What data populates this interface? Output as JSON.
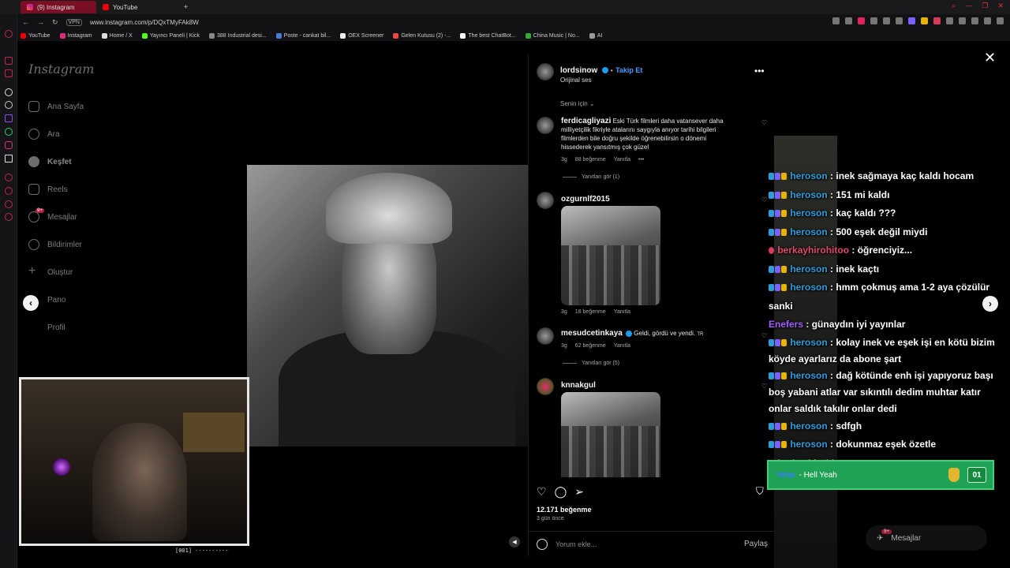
{
  "browser": {
    "tabs": [
      {
        "label": "(9) Instagram",
        "active": true
      },
      {
        "label": "YouTube",
        "active": false
      }
    ],
    "url": "www.instagram.com/p/DQxTMyFAk8W",
    "vpn_label": "VPN",
    "bookmarks": [
      "YouTube",
      "Instagram",
      "Home / X",
      "Yayıncı Paneli | Kick",
      "388 Industrial desi...",
      "Poste - cankat bil...",
      "OEX Screener",
      "Gelen Kutusu (2) -...",
      "The best ChatBot...",
      "China Music | No...",
      "AI"
    ]
  },
  "sidebar": {
    "logo": "Instagram",
    "items": [
      {
        "label": "Ana Sayfa",
        "icon": "home-icon"
      },
      {
        "label": "Ara",
        "icon": "search-icon"
      },
      {
        "label": "Keşfet",
        "icon": "compass-icon"
      },
      {
        "label": "Reels",
        "icon": "reels-icon"
      },
      {
        "label": "Mesajlar",
        "icon": "messenger-icon",
        "badge": "9+"
      },
      {
        "label": "Bildirimler",
        "icon": "heart-icon"
      },
      {
        "label": "Oluştur",
        "icon": "plus-icon"
      },
      {
        "label": "Pano",
        "icon": "dashboard-icon"
      },
      {
        "label": "Profil",
        "icon": "profile-icon"
      }
    ]
  },
  "post": {
    "author": "lordsinow",
    "follow_label": "Takip Et",
    "audio": "Orijinal ses",
    "sort_label": "Senin için",
    "likes": "12.171 beğenme",
    "time_ago": "3 gün önce",
    "comment_placeholder": "Yorum ekle...",
    "share_label": "Paylaş",
    "comments": [
      {
        "user": "ferdicagliyazi",
        "text": "Eski Türk filmleri daha vatansever daha milliyetçilik fikriyle atalarını saygıyla anıyor tarihi bilgileri filmlerden bile doğru şekilde öğrenebilirsin o dönemi hissederek yansıtmış çok güzel",
        "age": "3g",
        "likes": "88 beğenme",
        "reply": "Yanıtla",
        "replies": "Yanıtları gör (1)"
      },
      {
        "user": "ozgurnlf2015",
        "text": "",
        "age": "3g",
        "likes": "18 beğenme",
        "reply": "Yanıtla"
      },
      {
        "user": "mesudcetinkaya",
        "text": "Geldi, gördü ve yendi.",
        "flag": "TR",
        "age": "3g",
        "likes": "62 beğenme",
        "reply": "Yanıtla",
        "replies": "Yanıtları gör (5)"
      },
      {
        "user": "knnakgul",
        "text": "",
        "age": "",
        "likes": "",
        "reply": ""
      }
    ]
  },
  "stream": {
    "webcam_caption": "[001] ----------",
    "chat": [
      {
        "user": "heroson",
        "msg": "inek sağmaya kaç kaldı hocam",
        "user_color": "#2d9cdb",
        "badges": [
          "blue",
          "purple",
          "gold"
        ]
      },
      {
        "user": "heroson",
        "msg": "151 mi kaldı",
        "user_color": "#2d9cdb",
        "badges": [
          "blue",
          "purple",
          "gold"
        ]
      },
      {
        "user": "heroson",
        "msg": "kaç kaldı ???",
        "user_color": "#2d9cdb",
        "badges": [
          "blue",
          "purple",
          "gold"
        ]
      },
      {
        "user": "heroson",
        "msg": "500 eşek değil miydi",
        "user_color": "#2d9cdb",
        "badges": [
          "blue",
          "purple",
          "gold"
        ]
      },
      {
        "user": "berkayhirohitoo",
        "msg": "öğrenciyiz...",
        "user_color": "#e04a6a",
        "badges": [
          "red"
        ]
      },
      {
        "user": "heroson",
        "msg": "inek kaçtı",
        "user_color": "#2d9cdb",
        "badges": [
          "blue",
          "purple",
          "gold"
        ]
      },
      {
        "user": "heroson",
        "msg": "hmm çokmuş ama 1-2 aya çözülür sanki",
        "user_color": "#2d9cdb",
        "badges": [
          "blue",
          "purple",
          "gold"
        ]
      },
      {
        "user": "Enefers",
        "msg": "günaydın iyi yayınlar",
        "user_color": "#a25bff",
        "badges": []
      },
      {
        "user": "heroson",
        "msg": "kolay inek ve eşek işi en kötü bizim köyde ayarlarız da abone şart",
        "user_color": "#2d9cdb",
        "badges": [
          "blue",
          "purple",
          "gold"
        ]
      },
      {
        "user": "heroson",
        "msg": "dağ kötünde enh işi yapıyoruz başı boş yabani atlar var sıkıntılı dedim muhtar katır onlar saldık takılır onlar dedi",
        "user_color": "#2d9cdb",
        "badges": [
          "blue",
          "purple",
          "gold"
        ]
      },
      {
        "user": "heroson",
        "msg": "sdfgh",
        "user_color": "#2d9cdb",
        "badges": [
          "blue",
          "purple",
          "gold"
        ]
      },
      {
        "user": "heroson",
        "msg": "dokunmaz eşek özetle",
        "user_color": "#2d9cdb",
        "badges": [
          "blue",
          "purple",
          "gold"
        ]
      },
      {
        "user": "berkayhirohitoo",
        "msg": "",
        "user_color": "#e04a6a",
        "badges": [
          "red"
        ]
      }
    ],
    "alert": {
      "user": "Vefar",
      "text": "- Hell Yeah",
      "count": "01"
    },
    "messages_pill": {
      "label": "Mesajlar",
      "badge": "9+"
    }
  },
  "colors": {
    "accent_red": "#7a0e24",
    "instagram_blue": "#4a9cff",
    "alert_green": "#1fa255"
  }
}
